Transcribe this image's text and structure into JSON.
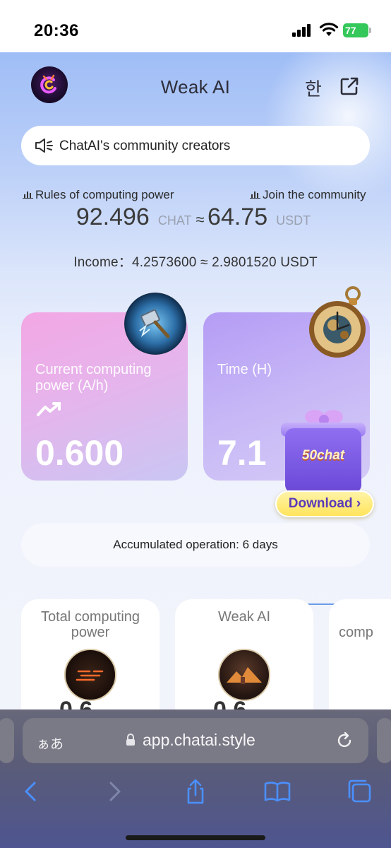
{
  "status_bar": {
    "time": "20:36",
    "battery": "77"
  },
  "header": {
    "title": "Weak AI",
    "lang_label": "한"
  },
  "notice": {
    "text": "ChatAI's community creators"
  },
  "links": {
    "rules": "Rules of computing power",
    "join": "Join the community"
  },
  "balance": {
    "amount": "92.496",
    "amount_unit": "CHAT",
    "approx_sign": "≈",
    "usdt_value": "64.75",
    "usdt_unit": "USDT"
  },
  "income": {
    "text": "Income：4.2573600 ≈ 2.9801520 USDT"
  },
  "cards": {
    "power": {
      "label": "Current computing power (A/h)",
      "value": "0.600"
    },
    "time": {
      "label": "Time (H)",
      "value": "7.1"
    }
  },
  "promo": {
    "gift_text": "50chat",
    "download_label": "Download ›"
  },
  "accumulated": {
    "text": "Accumulated operation: 6 days"
  },
  "mini_cards": [
    {
      "title": "Total computing power",
      "value_partial": "0.6"
    },
    {
      "title": "Weak AI",
      "value_partial": "0.6"
    },
    {
      "title": "comp"
    }
  ],
  "browser": {
    "aa_label": "ぁあ",
    "url": "app.chatai.style"
  },
  "colors": {
    "accent": "#6a48d8",
    "card_pink": "#f3a7e4",
    "card_purple": "#b49cf5",
    "download_yellow": "#ffe45c"
  }
}
